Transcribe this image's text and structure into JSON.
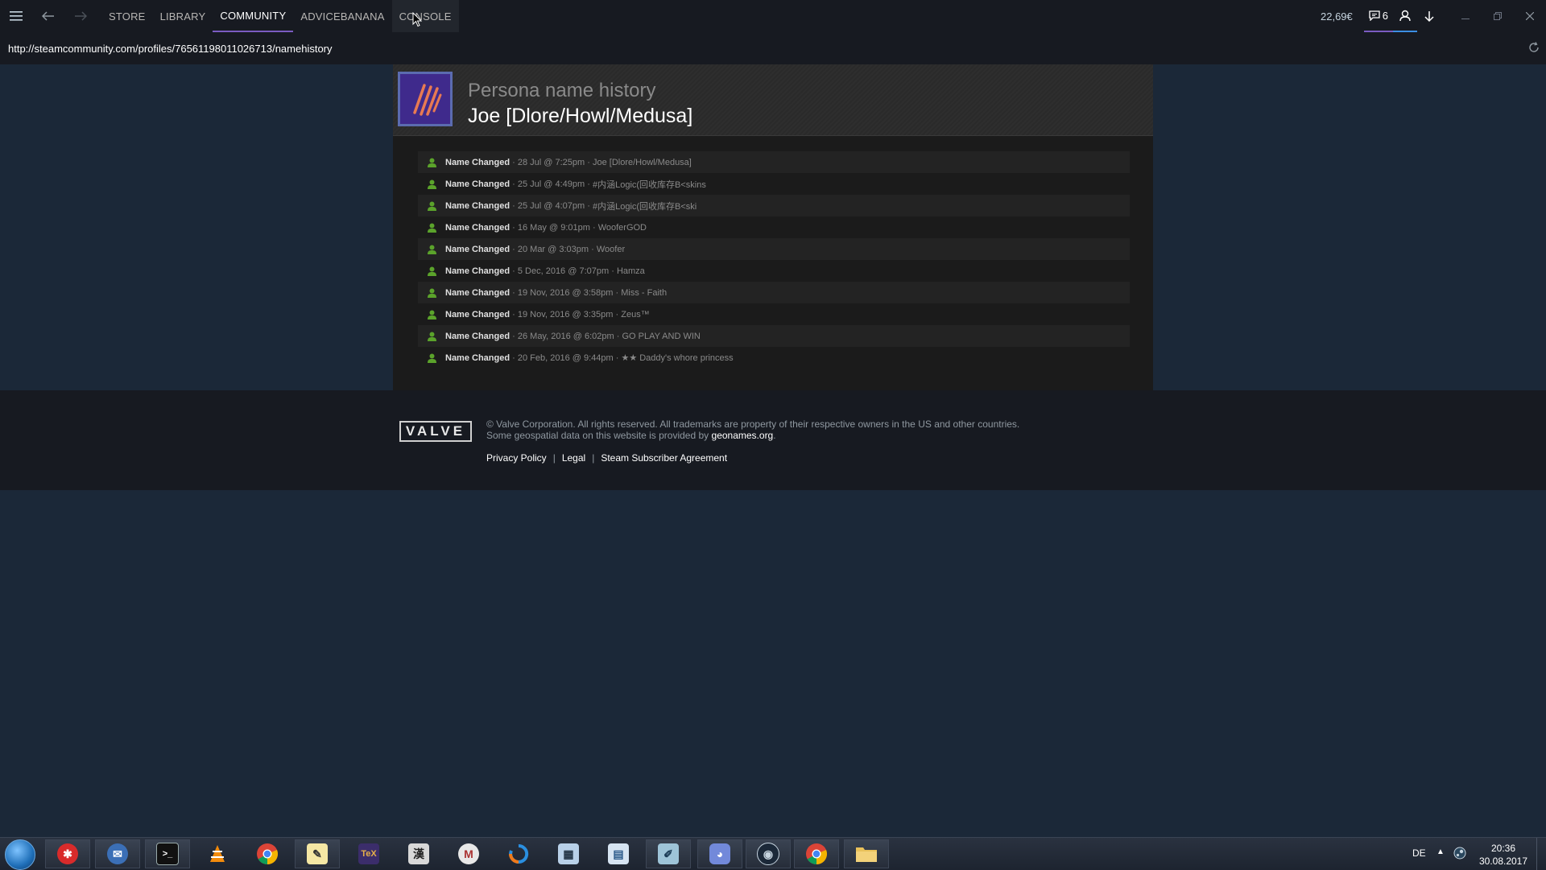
{
  "nav": {
    "tabs": [
      {
        "label": "STORE"
      },
      {
        "label": "LIBRARY"
      },
      {
        "label": "COMMUNITY"
      },
      {
        "label": "ADVICEBANANA"
      },
      {
        "label": "CONSOLE"
      }
    ],
    "active_tab": "COMMUNITY",
    "wallet": "22,69€",
    "notifications_count": "6",
    "accent_color": "#7b5cc2"
  },
  "urlbar": {
    "url": "http://steamcommunity.com/profiles/76561198011026713/namehistory"
  },
  "profile": {
    "subtitle": "Persona name history",
    "name": "Joe [Dlore/Howl/Medusa]"
  },
  "history": [
    {
      "label": "Name Changed",
      "date": "28 Jul @ 7:25pm",
      "name": "Joe [Dlore/Howl/Medusa]"
    },
    {
      "label": "Name Changed",
      "date": "25 Jul @ 4:49pm",
      "name": "#内涵Logic(回收库存B<skins"
    },
    {
      "label": "Name Changed",
      "date": "25 Jul @ 4:07pm",
      "name": "#内涵Logic(回收库存B<ski"
    },
    {
      "label": "Name Changed",
      "date": "16 May @ 9:01pm",
      "name": "WooferGOD"
    },
    {
      "label": "Name Changed",
      "date": "20 Mar @ 3:03pm",
      "name": "Woofer"
    },
    {
      "label": "Name Changed",
      "date": "5 Dec, 2016 @ 7:07pm",
      "name": "Hamza"
    },
    {
      "label": "Name Changed",
      "date": "19 Nov, 2016 @ 3:58pm",
      "name": "Miss - Faith"
    },
    {
      "label": "Name Changed",
      "date": "19 Nov, 2016 @ 3:35pm",
      "name": "Zeus™"
    },
    {
      "label": "Name Changed",
      "date": "26 May, 2016 @ 6:02pm",
      "name": "GO PLAY AND WIN"
    },
    {
      "label": "Name Changed",
      "date": "20 Feb, 2016 @ 9:44pm",
      "name": "★★ Daddy's whore princess"
    }
  ],
  "footer": {
    "logo_text": "VALVE",
    "legal_line1": "© Valve Corporation. All rights reserved. All trademarks are property of their respective owners in the US and other countries.",
    "legal_line2_prefix": "Some geospatial data on this website is provided by",
    "legal_link": "geonames.org",
    "legal_line2_suffix": ".",
    "links": [
      "Privacy Policy",
      "Legal",
      "Steam Subscriber Agreement"
    ],
    "separator": "|"
  },
  "taskbar": {
    "apps": [
      "tool-icon",
      "thunderbird-icon",
      "terminal-icon",
      "vlc-icon",
      "chrome-icon",
      "notepad-icon",
      "tex-icon",
      "chinese-char-icon",
      "m-icon",
      "sync-icon",
      "calculator-icon",
      "spreadsheet-icon",
      "pen-icon",
      "discord-icon",
      "steam-icon",
      "chrome-icon",
      "folder-icon"
    ],
    "language": "DE",
    "tray_arrow": "▲",
    "time": "20:36",
    "date": "30.08.2017"
  }
}
